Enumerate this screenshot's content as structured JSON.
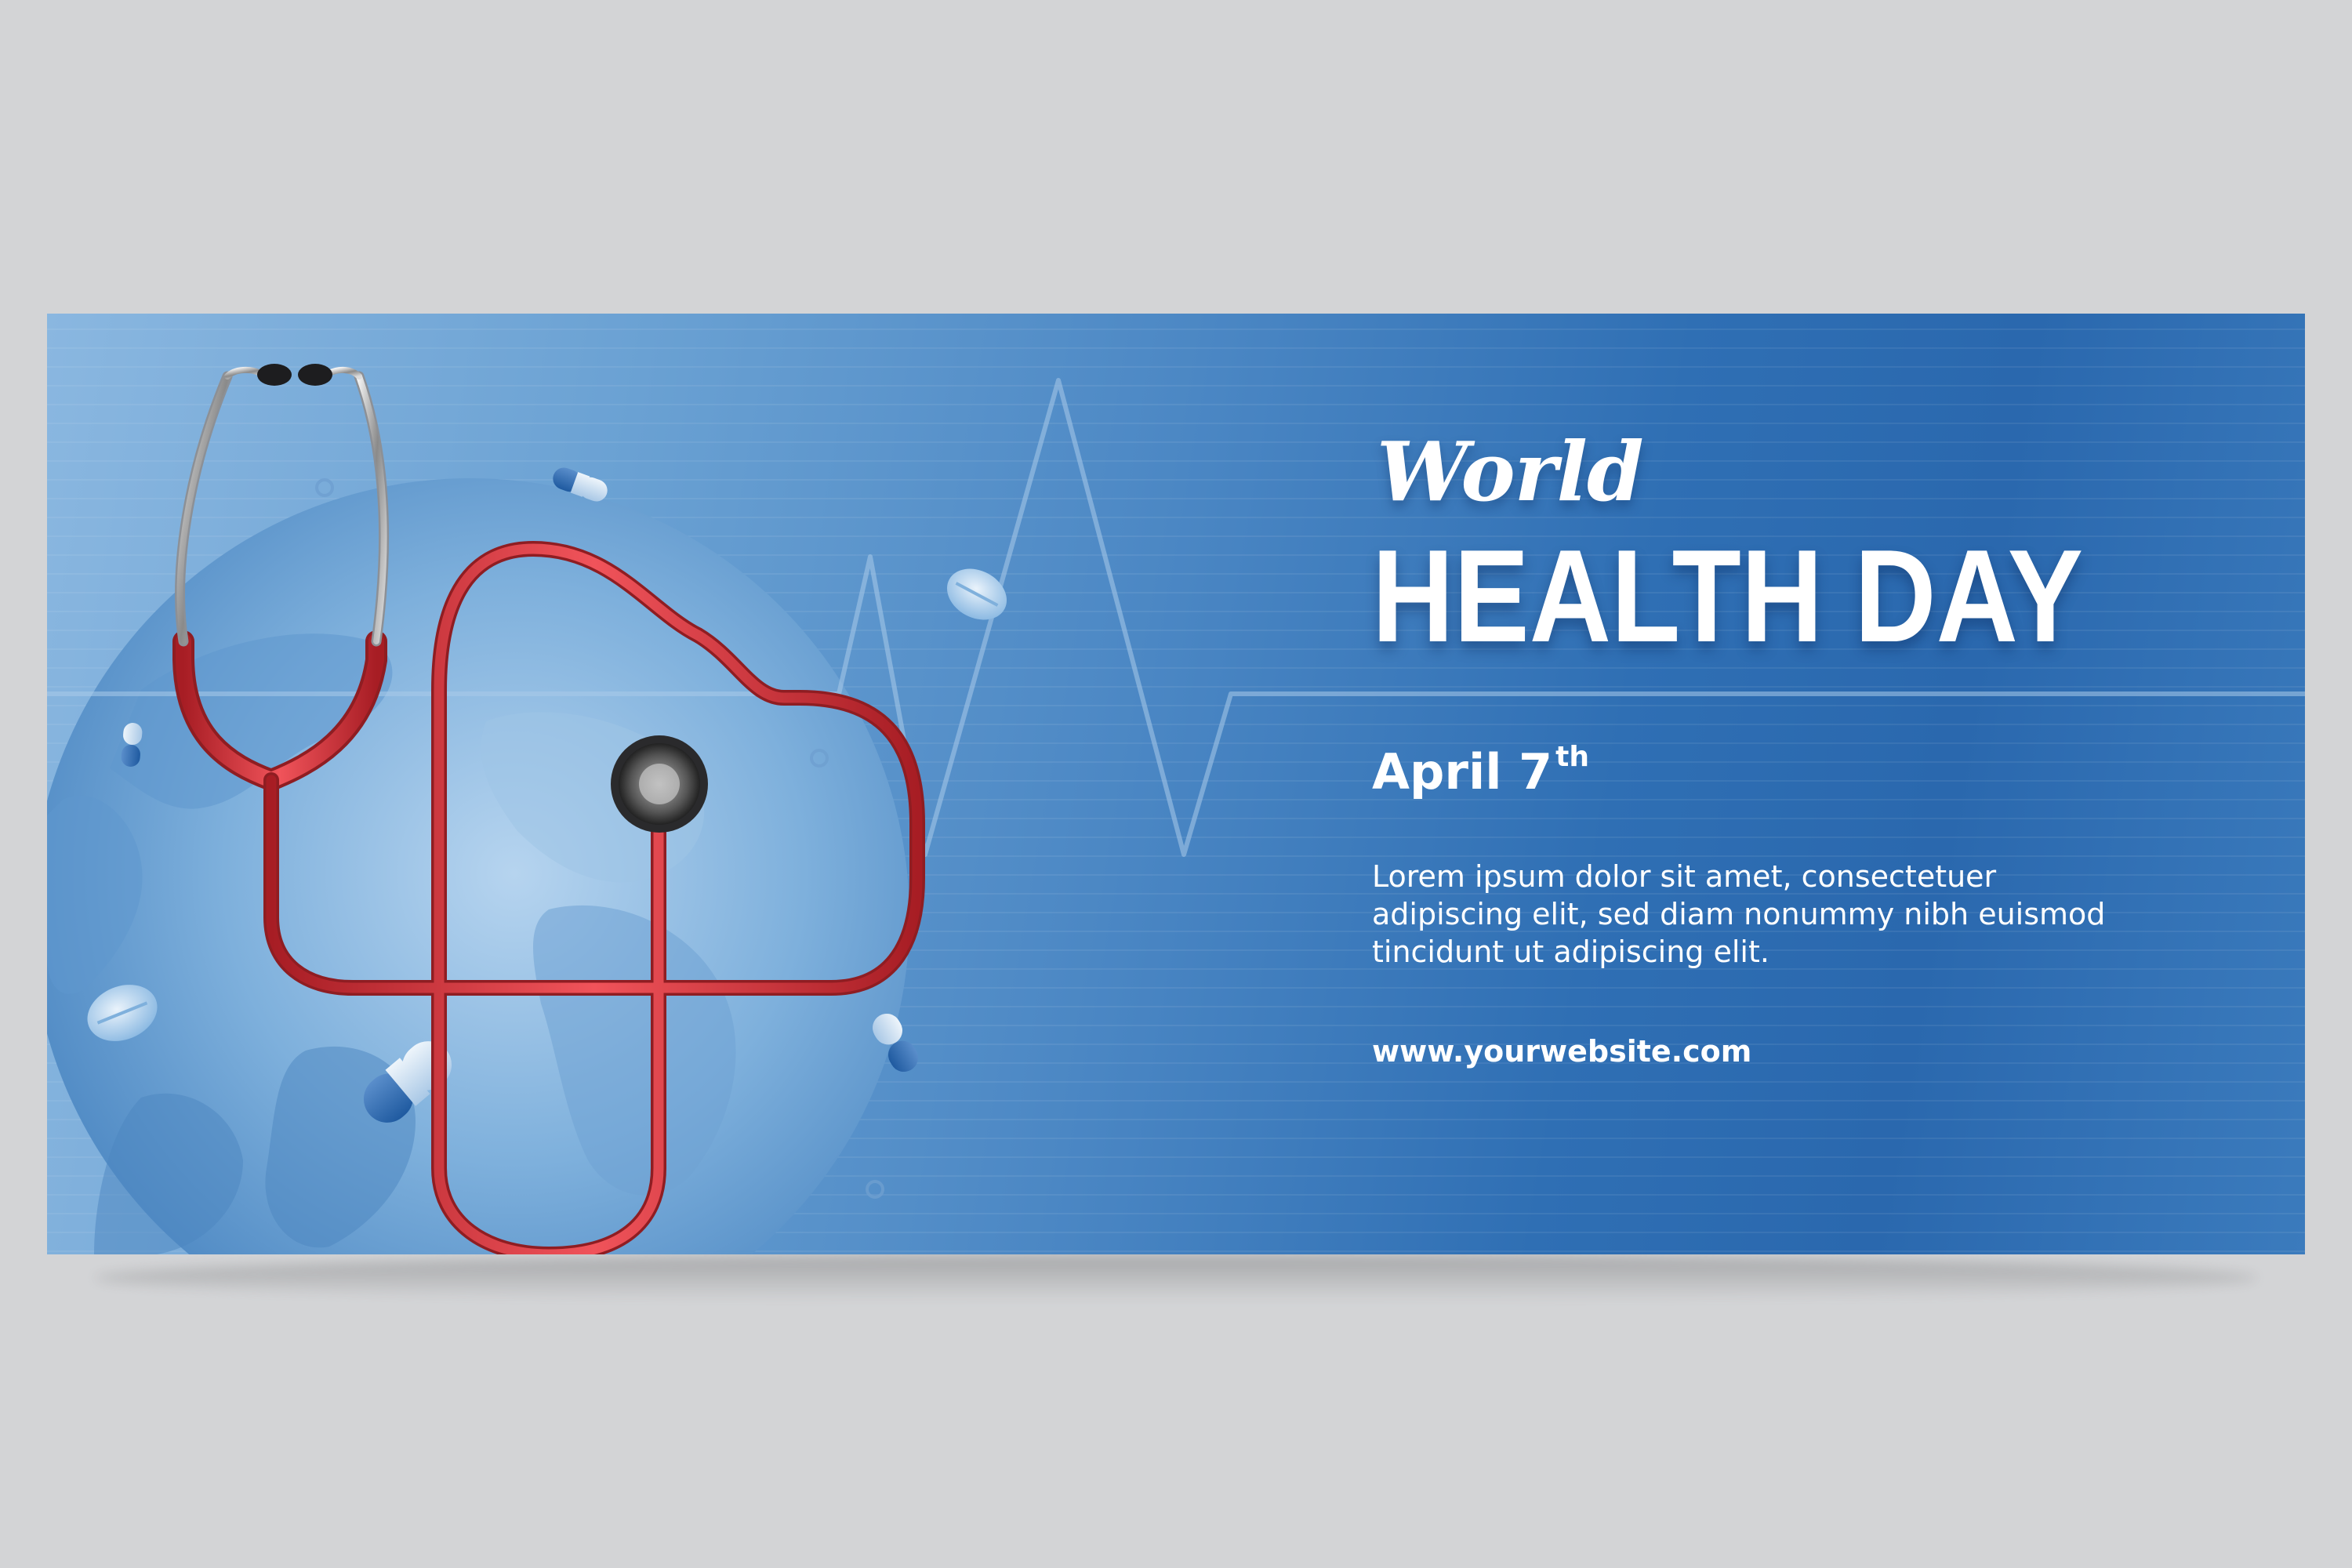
{
  "banner": {
    "title_script": "World",
    "title_main": "HEALTH DAY",
    "date_main": "April 7",
    "date_suffix": "th",
    "body_text": "Lorem ipsum dolor sit amet, consectetuer adipiscing elit, sed diam nonummy nibh euismod tincidunt ut adipiscing elit.",
    "website": "www.yourwebsite.com"
  },
  "colors": {
    "page_background": "#d3d4d6",
    "banner_blue_dark": "#2a68ae",
    "banner_blue_light": "#8ab7e0",
    "stethoscope_red": "#d8343a",
    "text_white": "#ffffff"
  },
  "icons": [
    "globe-illustration",
    "stethoscope-heart-icon",
    "heartbeat-line",
    "pill-capsule-icon",
    "pill-tablet-icon"
  ]
}
